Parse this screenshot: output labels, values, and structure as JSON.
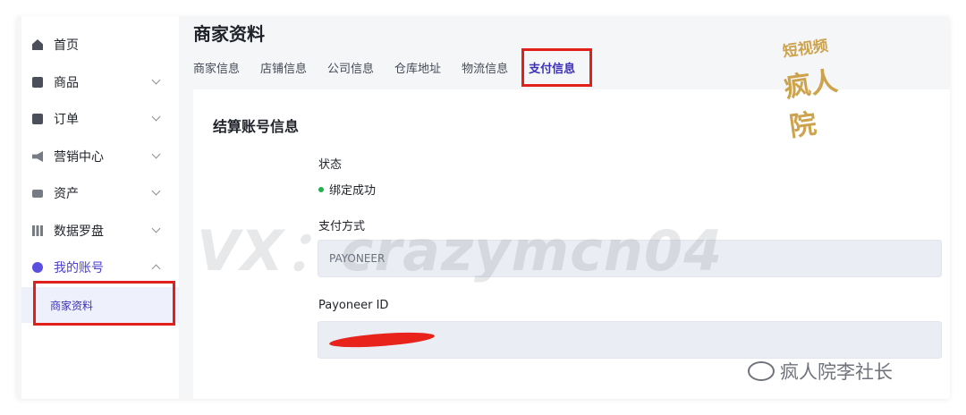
{
  "sidebar": {
    "items": [
      {
        "label": "首页",
        "icon": "home-icon",
        "has_chevron": false
      },
      {
        "label": "商品",
        "icon": "box-icon",
        "has_chevron": true
      },
      {
        "label": "订单",
        "icon": "document-icon",
        "has_chevron": true
      },
      {
        "label": "营销中心",
        "icon": "megaphone-icon",
        "has_chevron": true
      },
      {
        "label": "资产",
        "icon": "card-icon",
        "has_chevron": true
      },
      {
        "label": "数据罗盘",
        "icon": "chart-bars-icon",
        "has_chevron": true
      },
      {
        "label": "我的账号",
        "icon": "user-icon",
        "has_chevron": true,
        "expanded": true,
        "active": true
      }
    ],
    "sub_item": "商家资料"
  },
  "page": {
    "title": "商家资料",
    "tabs": [
      "商家信息",
      "店铺信息",
      "公司信息",
      "仓库地址",
      "物流信息",
      "支付信息"
    ],
    "active_tab": "支付信息"
  },
  "card": {
    "title": "结算账号信息",
    "status_label": "状态",
    "status_value": "绑定成功",
    "method_label": "支付方式",
    "method_value": "PAYONEER",
    "payoneer_label": "Payoneer ID",
    "payoneer_value": ""
  },
  "watermarks": {
    "vx": "VX：crazymcn04",
    "wechat": "疯人院李社长",
    "logo": "短视频疯人院"
  },
  "colors": {
    "accent": "#5b4fe0",
    "highlight_box": "#e0201b",
    "status_ok": "#22b14c"
  }
}
